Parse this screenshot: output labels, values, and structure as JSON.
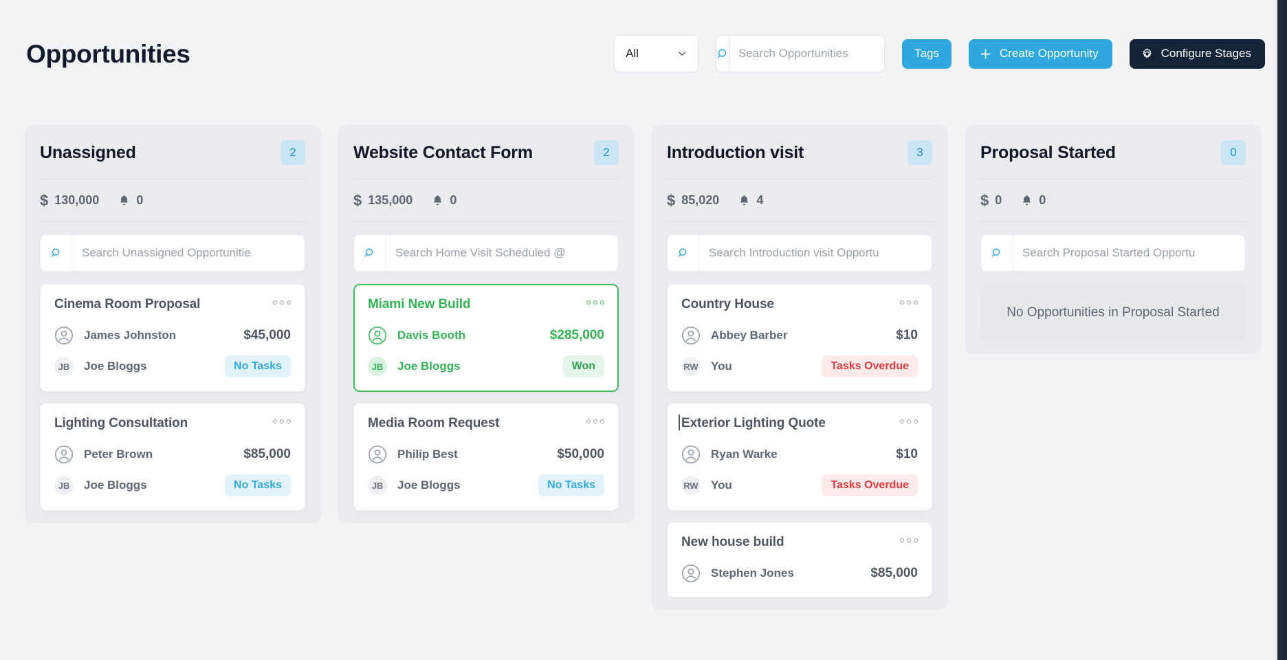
{
  "header": {
    "title": "Opportunities",
    "filter": {
      "value": "All",
      "icon": "chevron-down-icon"
    },
    "search": {
      "value": "",
      "placeholder": "Search Opportunities",
      "icon": "search-icon"
    },
    "tags_label": "Tags",
    "create_label": "Create Opportunity",
    "configure_label": "Configure Stages"
  },
  "colors": {
    "accent_blue": "#2fa8e0",
    "dark_navy": "#132338",
    "won_green": "#34b356",
    "overdue_red": "#e0383e",
    "column_bg": "#e9ebee",
    "page_bg": "#f1f3f5"
  },
  "columns": [
    {
      "title": "Unassigned",
      "count": "2",
      "value": "130,000",
      "notifications": "0",
      "search_placeholder": "Search Unassigned Opportunitie",
      "search_value": "",
      "empty_text": "",
      "cards": [
        {
          "title": "Cinema Room Proposal",
          "contact": "James Johnston",
          "amount": "$45,000",
          "owner_initials": "JB",
          "owner": "Joe Bloggs",
          "badge": "No Tasks",
          "badge_type": "notasks"
        },
        {
          "title": "Lighting Consultation",
          "contact": "Peter Brown",
          "amount": "$85,000",
          "owner_initials": "JB",
          "owner": "Joe Bloggs",
          "badge": "No Tasks",
          "badge_type": "notasks"
        }
      ]
    },
    {
      "title": "Website Contact Form",
      "count": "2",
      "value": "135,000",
      "notifications": "0",
      "search_placeholder": "Search Home Visit Scheduled @",
      "search_value": "",
      "empty_text": "",
      "cards": [
        {
          "title": "Miami New Build",
          "contact": "Davis Booth",
          "amount": "$285,000",
          "owner_initials": "JB",
          "owner": "Joe Bloggs",
          "badge": "Won",
          "badge_type": "won",
          "state": "won"
        },
        {
          "title": "Media Room Request",
          "contact": "Philip Best",
          "amount": "$50,000",
          "owner_initials": "JB",
          "owner": "Joe Bloggs",
          "badge": "No Tasks",
          "badge_type": "notasks"
        }
      ]
    },
    {
      "title": "Introduction visit",
      "count": "3",
      "value": "85,020",
      "notifications": "4",
      "search_placeholder": "Search Introduction visit Opportu",
      "search_value": "",
      "empty_text": "",
      "cards": [
        {
          "title": "Country House",
          "contact": "Abbey Barber",
          "amount": "$10",
          "owner_initials": "RW",
          "owner": "You",
          "badge": "Tasks Overdue",
          "badge_type": "overdue"
        },
        {
          "title": "Exterior Lighting Quote",
          "contact": "Ryan Warke",
          "amount": "$10",
          "owner_initials": "RW",
          "owner": "You",
          "badge": "Tasks Overdue",
          "badge_type": "overdue",
          "state": "caret"
        },
        {
          "title": "New house build",
          "contact": "Stephen Jones",
          "amount": "$85,000",
          "owner_initials": "",
          "owner": "",
          "badge": "",
          "badge_type": "none"
        }
      ]
    },
    {
      "title": "Proposal Started",
      "count": "0",
      "value": "0",
      "notifications": "0",
      "search_placeholder": "Search Proposal Started Opportu",
      "search_value": "",
      "empty_text": "No Opportunities in Proposal Started",
      "cards": []
    }
  ]
}
